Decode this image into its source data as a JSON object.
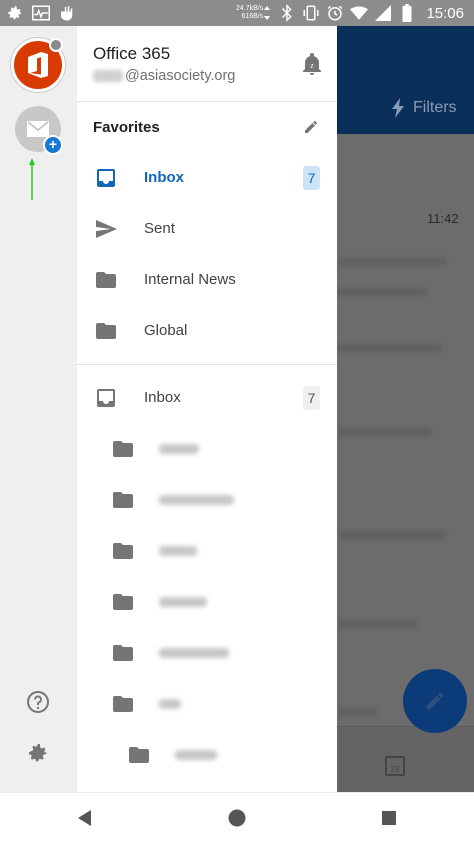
{
  "status_bar": {
    "net_speed_up": "24.7kB/s",
    "net_speed_down": "616B/s",
    "time": "15:06",
    "left_icons": [
      "settings-icon",
      "activity-icon",
      "hand-icon"
    ],
    "right_icons": [
      "bluetooth-icon",
      "vibrate-icon",
      "alarm-icon",
      "wifi-icon",
      "signal-icon",
      "battery-icon"
    ]
  },
  "account": {
    "name": "Office 365",
    "email": "@asiasociety.org"
  },
  "favorites": {
    "title": "Favorites",
    "items": [
      {
        "label": "Inbox",
        "icon": "inbox-icon",
        "badge": "7",
        "selected": true
      },
      {
        "label": "Sent",
        "icon": "send-icon"
      },
      {
        "label": "Internal News",
        "icon": "folder-icon"
      },
      {
        "label": "Global",
        "icon": "folder-icon"
      }
    ]
  },
  "folders": {
    "inbox": {
      "label": "Inbox",
      "badge": "7"
    }
  },
  "background_app": {
    "filters_label": "Filters",
    "time": "11:42",
    "calendar_day": "29"
  },
  "colors": {
    "accent": "#1466b8",
    "office_red": "#d83b01",
    "add_badge": "#1479d4",
    "arrow": "#22cc22"
  }
}
